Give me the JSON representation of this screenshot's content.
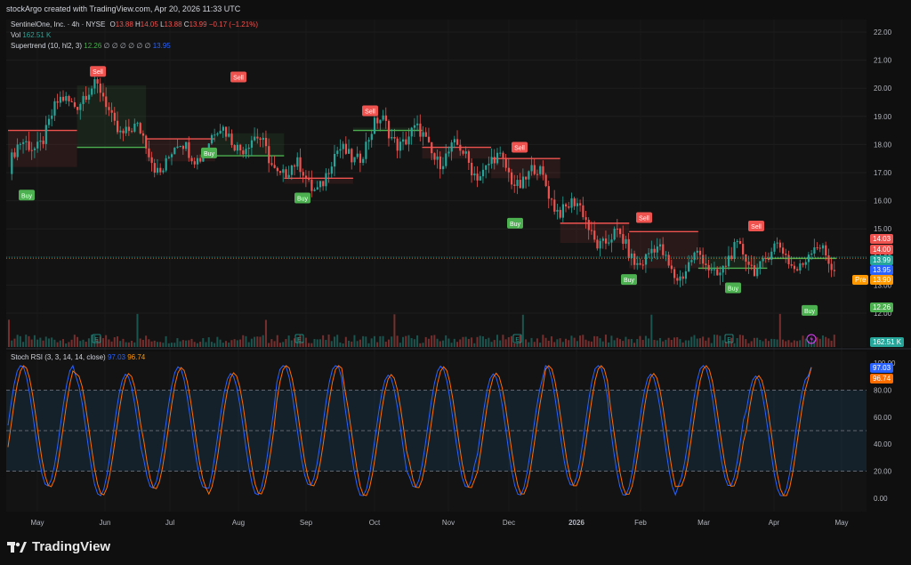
{
  "header": {
    "creator_line": "stockArgo created with TradingView.com, Apr 20, 2026 11:33 UTC"
  },
  "legend_main": {
    "symbol": "SentinelOne, Inc. · 4h · NYSE",
    "o_label": "O",
    "o": "13.88",
    "h_label": "H",
    "h": "14.05",
    "l_label": "L",
    "l": "13.88",
    "c_label": "C",
    "c": "13.99",
    "change": "−0.17 (−1.21%)",
    "vol_label": "Vol",
    "vol": "162.51 K",
    "st_label": "Supertrend (10, hl2, 3)",
    "st_up": "12.26",
    "st_placeholders": "∅ ∅ ∅ ∅ ∅ ∅",
    "st_down": "13.95"
  },
  "legend_rsi": {
    "label": "Stoch RSI (3, 3, 14, 14, close)",
    "k": "97.03",
    "d": "96.74"
  },
  "colors": {
    "up": "#26a69a",
    "down": "#ef5350",
    "st_up": "#4caf50",
    "st_down": "#ef5350",
    "k_line": "#2962ff",
    "d_line": "#ff6d00"
  },
  "price_axis": {
    "ticks": [
      "22.00",
      "21.00",
      "20.00",
      "19.00",
      "18.00",
      "17.00",
      "16.00",
      "15.00",
      "14.00",
      "13.00",
      "12.00"
    ],
    "tags": {
      "high": "14.03",
      "open": "14.00",
      "close": "13.99",
      "st_line": "13.95",
      "pre_label": "Pre",
      "pre": "13.90",
      "st_up": "12.26",
      "volume": "162.51 K"
    }
  },
  "rsi_axis": {
    "ticks": [
      "100.00",
      "80.00",
      "60.00",
      "40.00",
      "20.00",
      "0.00"
    ],
    "tags": {
      "k": "97.03",
      "d": "96.74"
    }
  },
  "time_axis": {
    "labels": [
      "May",
      "Jun",
      "Jul",
      "Aug",
      "Sep",
      "Oct",
      "Nov",
      "Dec",
      "2026",
      "Feb",
      "Mar",
      "Apr",
      "May"
    ]
  },
  "signals": {
    "buy": "Buy",
    "sell": "Sell",
    "earnings_marker": "E"
  },
  "brand": {
    "name": "TradingView"
  },
  "chart_data": [
    {
      "type": "line",
      "title": "SentinelOne, Inc. · 4h · NYSE",
      "ylim": [
        11.5,
        22.2
      ],
      "x": [
        "May",
        "Jun",
        "Jul",
        "Aug",
        "Sep",
        "Oct",
        "Nov",
        "Dec",
        "2026",
        "Feb",
        "Mar",
        "Apr"
      ],
      "series": [
        {
          "name": "close",
          "values": [
            17.2,
            20.1,
            17.4,
            18.4,
            16.6,
            18.6,
            17.5,
            16.8,
            14.5,
            13.6,
            14.0,
            13.99
          ]
        },
        {
          "name": "Supertrend (10, hl2, 3)",
          "values": [
            18.5,
            17.9,
            18.2,
            17.6,
            16.8,
            18.5,
            17.9,
            17.5,
            15.2,
            14.9,
            13.6,
            13.95
          ]
        }
      ],
      "signals": [
        {
          "type": "Buy",
          "x": "Apr (2025)",
          "price": 16.2
        },
        {
          "type": "Sell",
          "x": "late May",
          "price": 20.6
        },
        {
          "type": "Buy",
          "x": "mid Jul",
          "price": 17.7
        },
        {
          "type": "Sell",
          "x": "late Jul",
          "price": 20.4
        },
        {
          "type": "Buy",
          "x": "late Aug",
          "price": 16.1
        },
        {
          "type": "Sell",
          "x": "late Sep",
          "price": 19.2
        },
        {
          "type": "Sell",
          "x": "late Nov",
          "price": 17.9
        },
        {
          "type": "Buy",
          "x": "early Dec",
          "price": 15.2
        },
        {
          "type": "Sell",
          "x": "mid Jan",
          "price": 15.4
        },
        {
          "type": "Buy",
          "x": "late Jan",
          "price": 13.2
        },
        {
          "type": "Buy",
          "x": "mid Mar",
          "price": 12.9
        },
        {
          "type": "Sell",
          "x": "late Mar",
          "price": 15.1
        },
        {
          "type": "Buy",
          "x": "mid Apr",
          "price": 12.1
        }
      ]
    },
    {
      "type": "line",
      "title": "Stoch RSI (3, 3, 14, 14, close)",
      "ylim": [
        0,
        100
      ],
      "bands": [
        20,
        50,
        80
      ],
      "series": [
        {
          "name": "K",
          "values": [
            97,
            20,
            85,
            40,
            95,
            10,
            90,
            35,
            96,
            15,
            80,
            5,
            97
          ]
        },
        {
          "name": "D",
          "values": [
            90,
            25,
            80,
            45,
            90,
            15,
            85,
            40,
            90,
            20,
            75,
            10,
            96.74
          ]
        }
      ]
    }
  ]
}
